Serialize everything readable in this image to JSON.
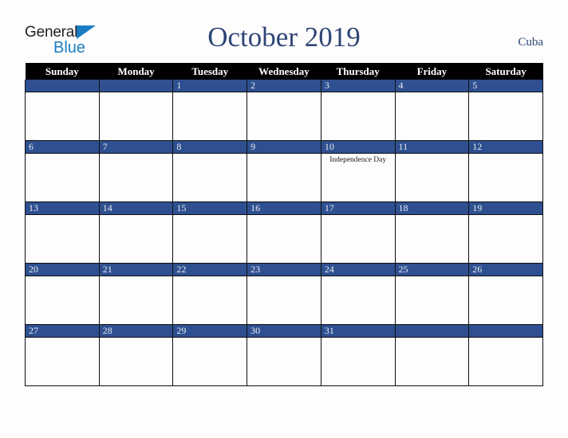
{
  "brand": {
    "name_part1": "General",
    "name_part2": "Blue",
    "triangle_icon": "blue-triangle-icon",
    "accent_color": "#1a7dc4"
  },
  "header": {
    "month_title": "October 2019",
    "country": "Cuba",
    "title_color": "#2e4576"
  },
  "calendar": {
    "weekday_headers": [
      "Sunday",
      "Monday",
      "Tuesday",
      "Wednesday",
      "Thursday",
      "Friday",
      "Saturday"
    ],
    "header_bg": "#000000",
    "daynum_band_color": "#2e5090",
    "daynum_text_color": "#e8eaf1",
    "weeks": [
      [
        {
          "day": "",
          "event": ""
        },
        {
          "day": "",
          "event": ""
        },
        {
          "day": "1",
          "event": ""
        },
        {
          "day": "2",
          "event": ""
        },
        {
          "day": "3",
          "event": ""
        },
        {
          "day": "4",
          "event": ""
        },
        {
          "day": "5",
          "event": ""
        }
      ],
      [
        {
          "day": "6",
          "event": ""
        },
        {
          "day": "7",
          "event": ""
        },
        {
          "day": "8",
          "event": ""
        },
        {
          "day": "9",
          "event": ""
        },
        {
          "day": "10",
          "event": "Independence Day"
        },
        {
          "day": "11",
          "event": ""
        },
        {
          "day": "12",
          "event": ""
        }
      ],
      [
        {
          "day": "13",
          "event": ""
        },
        {
          "day": "14",
          "event": ""
        },
        {
          "day": "15",
          "event": ""
        },
        {
          "day": "16",
          "event": ""
        },
        {
          "day": "17",
          "event": ""
        },
        {
          "day": "18",
          "event": ""
        },
        {
          "day": "19",
          "event": ""
        }
      ],
      [
        {
          "day": "20",
          "event": ""
        },
        {
          "day": "21",
          "event": ""
        },
        {
          "day": "22",
          "event": ""
        },
        {
          "day": "23",
          "event": ""
        },
        {
          "day": "24",
          "event": ""
        },
        {
          "day": "25",
          "event": ""
        },
        {
          "day": "26",
          "event": ""
        }
      ],
      [
        {
          "day": "27",
          "event": ""
        },
        {
          "day": "28",
          "event": ""
        },
        {
          "day": "29",
          "event": ""
        },
        {
          "day": "30",
          "event": ""
        },
        {
          "day": "31",
          "event": ""
        },
        {
          "day": "",
          "event": ""
        },
        {
          "day": "",
          "event": ""
        }
      ]
    ]
  }
}
